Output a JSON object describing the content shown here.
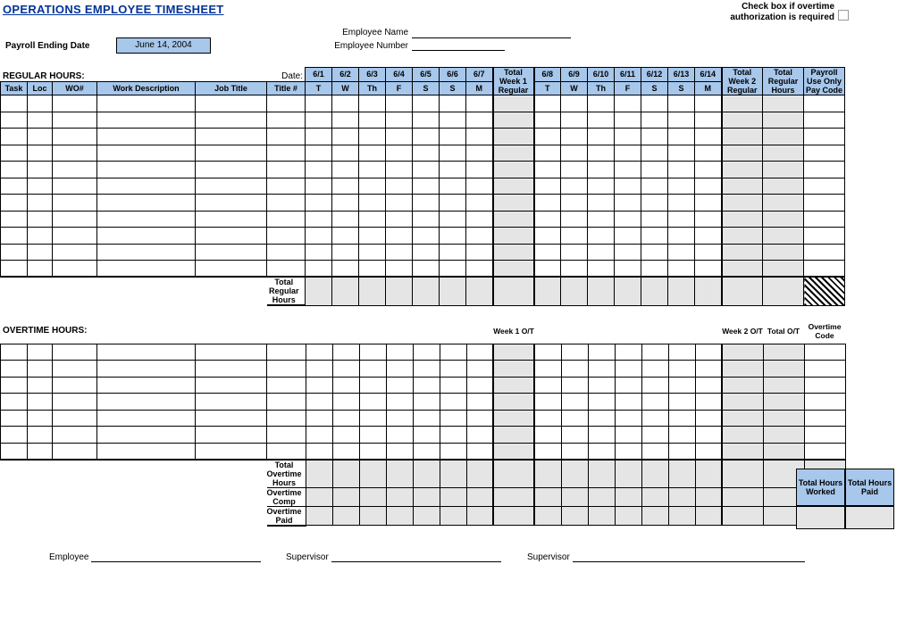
{
  "title": "OPERATIONS EMPLOYEE TIMESHEET",
  "check_note": "Check box if overtime authorization is required",
  "payroll_label": "Payroll Ending Date",
  "payroll_date": "June 14, 2004",
  "emp_name_label": "Employee Name",
  "emp_no_label": "Employee Number",
  "regular_label": "REGULAR HOURS:",
  "date_label": "Date:",
  "overtime_label": "OVERTIME HOURS:",
  "cols": {
    "task": "Task",
    "loc": "Loc",
    "wo": "WO#",
    "desc": "Work Description",
    "job": "Job Title",
    "title": "Title #"
  },
  "dates": [
    "6/1",
    "6/2",
    "6/3",
    "6/4",
    "6/5",
    "6/6",
    "6/7",
    "6/8",
    "6/9",
    "6/10",
    "6/11",
    "6/12",
    "6/13",
    "6/14"
  ],
  "dow": [
    "T",
    "W",
    "Th",
    "F",
    "S",
    "S",
    "M",
    "T",
    "W",
    "Th",
    "F",
    "S",
    "S",
    "M"
  ],
  "week1": "Total Week 1 Regular",
  "week2": "Total Week  2 Regular",
  "tot_reg": "Total Regular Hours",
  "pay_code": "Payroll Use Only Pay Code",
  "tot_reg_row": "Total Regular Hours",
  "wk1_ot": "Week 1 O/T",
  "wk2_ot": "Week 2 O/T",
  "tot_ot": "Total O/T",
  "ot_code": "Overtime Code",
  "tot_ot_row": "Total Overtime Hours",
  "ot_comp": "Overtime Comp",
  "ot_paid": "Overtime Paid",
  "thw": "Total Hours Worked",
  "thp": "Total Hours Paid",
  "sig_emp": "Employee",
  "sig_sup": "Supervisor"
}
